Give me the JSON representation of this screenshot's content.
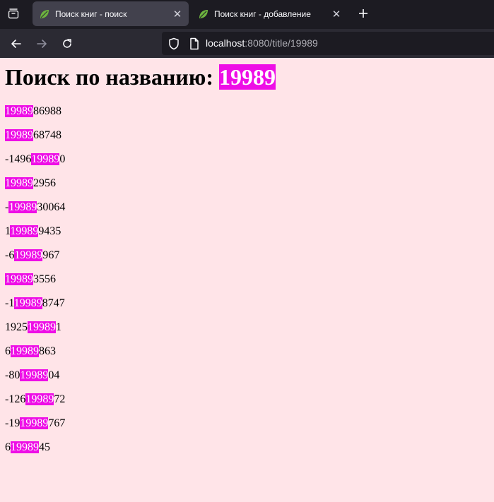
{
  "browser": {
    "tabs": [
      {
        "title": "Поиск книг - поиск",
        "active": true
      },
      {
        "title": "Поиск книг - добавление",
        "active": false
      }
    ],
    "url": {
      "host": "localhost",
      "rest": ":8080/title/19989"
    }
  },
  "page": {
    "heading_prefix": "Поиск по названию: ",
    "query": "19989",
    "highlight_color": "#ee0ee6",
    "results": [
      {
        "before": "",
        "match": "19989",
        "after": "86988"
      },
      {
        "before": "",
        "match": "19989",
        "after": "68748"
      },
      {
        "before": "-1496",
        "match": "19989",
        "after": "0"
      },
      {
        "before": "",
        "match": "19989",
        "after": "2956"
      },
      {
        "before": "-",
        "match": "19989",
        "after": "30064"
      },
      {
        "before": "1",
        "match": "19989",
        "after": "9435"
      },
      {
        "before": "-6",
        "match": "19989",
        "after": "967"
      },
      {
        "before": "",
        "match": "19989",
        "after": "3556"
      },
      {
        "before": "-1",
        "match": "19989",
        "after": "8747"
      },
      {
        "before": "1925",
        "match": "19989",
        "after": "1"
      },
      {
        "before": "6",
        "match": "19989",
        "after": "863"
      },
      {
        "before": "-80",
        "match": "19989",
        "after": "04"
      },
      {
        "before": "-126",
        "match": "19989",
        "after": "72"
      },
      {
        "before": "-19",
        "match": "19989",
        "after": "767"
      },
      {
        "before": "6",
        "match": "19989",
        "after": "45"
      }
    ]
  }
}
